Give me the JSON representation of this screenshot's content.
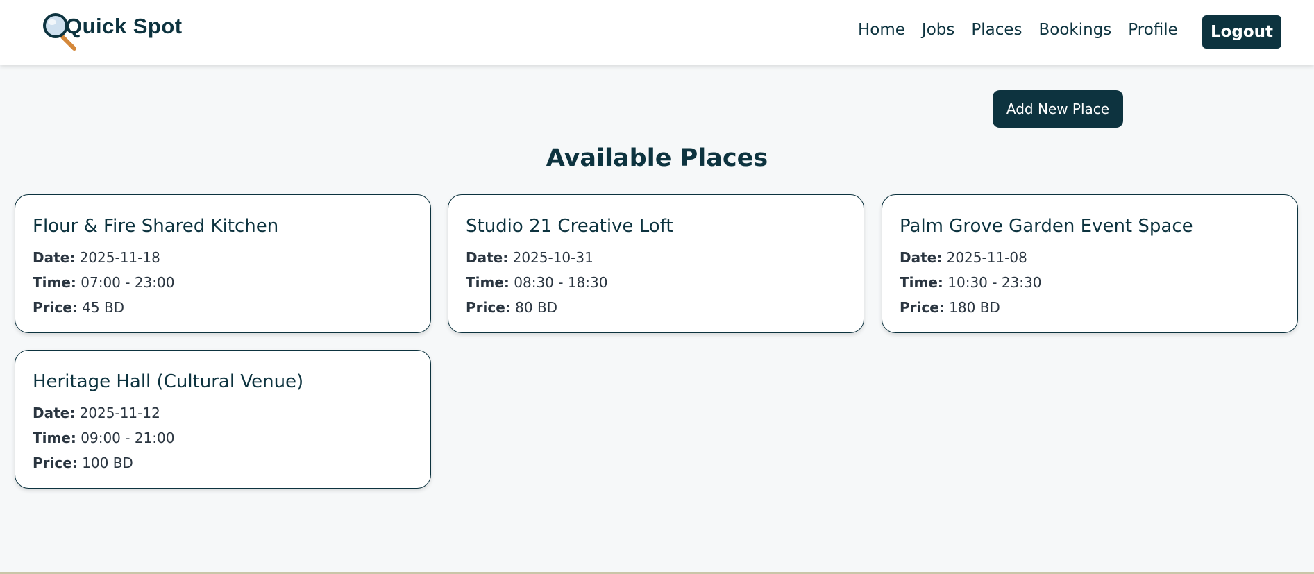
{
  "brand": {
    "name": "Quick Spot",
    "accent": "#0d333f"
  },
  "nav": {
    "links": [
      "Home",
      "Jobs",
      "Places",
      "Bookings",
      "Profile"
    ],
    "logout_label": "Logout"
  },
  "main": {
    "add_button_label": "Add New Place",
    "section_title": "Available Places",
    "labels": {
      "date": "Date:",
      "time": "Time:",
      "price": "Price:"
    },
    "places": [
      {
        "name": "Flour & Fire Shared Kitchen",
        "date": "2025-11-18",
        "time": "07:00 - 23:00",
        "price": "45 BD"
      },
      {
        "name": "Studio 21 Creative Loft",
        "date": "2025-10-31",
        "time": "08:30 - 18:30",
        "price": "80 BD"
      },
      {
        "name": "Palm Grove Garden Event Space",
        "date": "2025-11-08",
        "time": "10:30 - 23:30",
        "price": "180 BD"
      },
      {
        "name": "Heritage Hall (Cultural Venue)",
        "date": "2025-11-12",
        "time": "09:00 - 21:00",
        "price": "100 BD"
      }
    ]
  }
}
